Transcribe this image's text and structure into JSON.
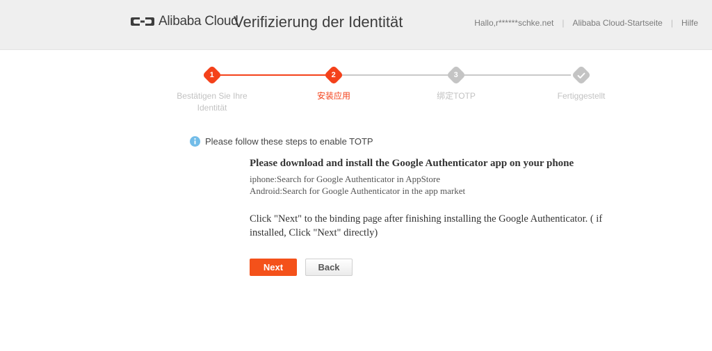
{
  "header": {
    "logo_icon": "alibaba-cloud-logo-icon",
    "logo_text": "Alibaba Cloud",
    "title": "Verifizierung der Identität",
    "links": [
      {
        "label": "Hallo,r******schke.net"
      },
      {
        "label": "Alibaba Cloud-Startseite"
      },
      {
        "label": "Hilfe"
      }
    ],
    "separator": "|"
  },
  "stepper": {
    "steps": [
      {
        "number": "1",
        "label": "Bestätigen Sie Ihre Identität",
        "state": "done"
      },
      {
        "number": "2",
        "label": "安装应用",
        "state": "current"
      },
      {
        "number": "3",
        "label": "绑定TOTP",
        "state": "todo"
      },
      {
        "number": "✓",
        "label": "Fertiggestellt",
        "state": "todo"
      }
    ]
  },
  "notice": {
    "icon": "info-icon",
    "text": "Please follow these steps to enable TOTP"
  },
  "instructions": {
    "lead": "Please download and install the Google Authenticator app on your phone",
    "iphone_line": "iphone:Search for Google Authenticator in AppStore",
    "android_line": "Android:Search for Google Authenticator in the app market",
    "paragraph": "Click \"Next\" to the binding page after finishing installing the Google Authenticator. ( if installed, Click \"Next\" directly)"
  },
  "actions": {
    "next_label": "Next",
    "back_label": "Back"
  },
  "colors": {
    "accent_orange": "#f4511a",
    "step_inactive": "#c4c4c4",
    "header_bg": "#efefef",
    "info_blue": "#72bce8"
  }
}
